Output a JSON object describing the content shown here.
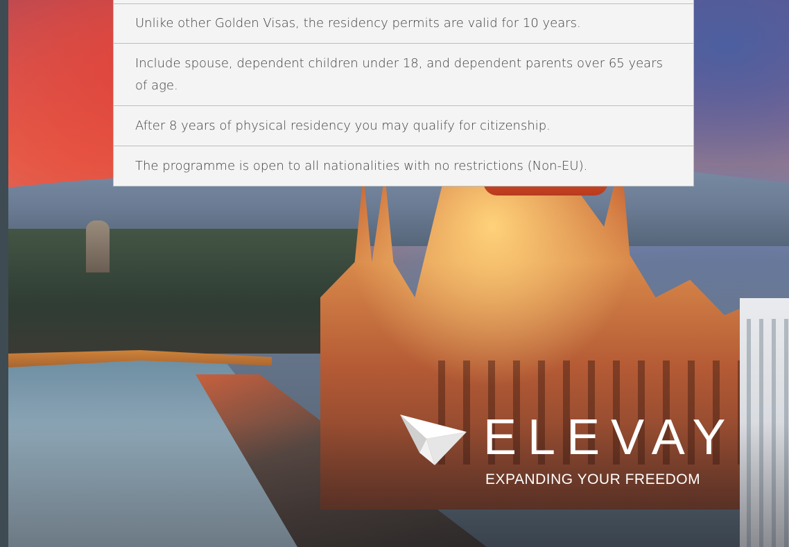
{
  "info_list": {
    "items": [
      "Unlike other Golden Visas, the residency permits are valid for 10 years.",
      "Include spouse, dependent children under 18, and dependent parents over 65 years of age.",
      "After 8 years of physical residency you may qualify for citizenship.",
      "The programme is open to all nationalities with no restrictions (Non-EU)."
    ]
  },
  "brand": {
    "name": "ELEVAY",
    "tagline": "EXPANDING YOUR FREEDOM",
    "logo_icon": "paper-plane-logo-icon"
  },
  "colors": {
    "panel_background": "#f4f4f4",
    "panel_border": "#b9bec3",
    "text": "#3d3d40",
    "brand_text": "#ffffff"
  }
}
